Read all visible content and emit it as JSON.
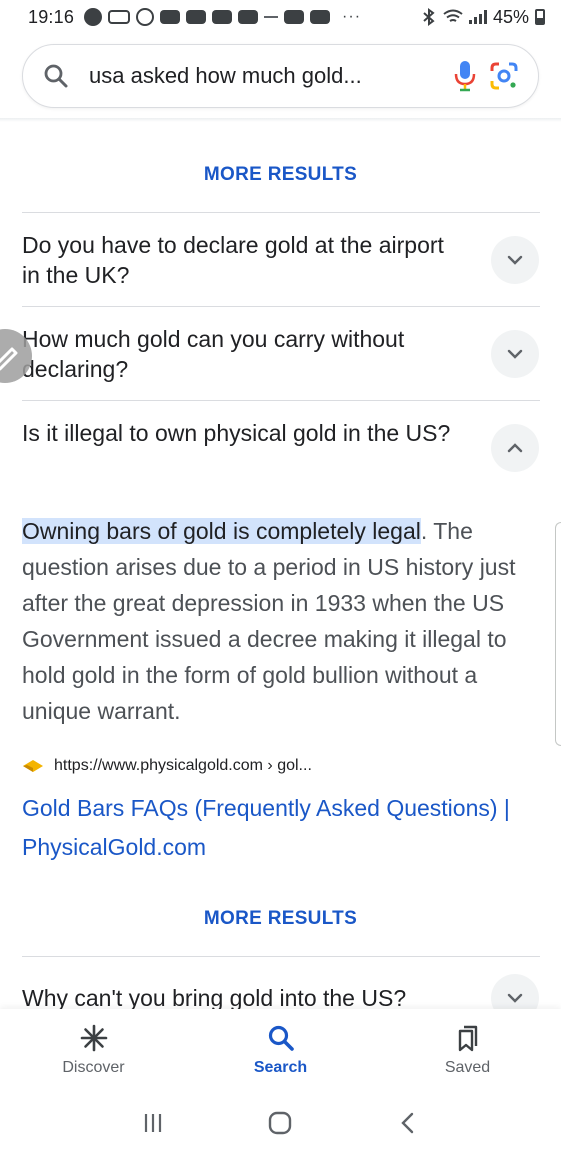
{
  "status_bar": {
    "time": "19:16",
    "battery": "45%"
  },
  "search": {
    "query": "usa asked how much gold..."
  },
  "content": {
    "more_results_top": "MORE RESULTS",
    "questions": [
      {
        "text": "Do you have to declare gold at the airport in the UK?",
        "expanded": false
      },
      {
        "text": "How much gold can you carry without declaring?",
        "expanded": false
      },
      {
        "text": "Is it illegal to own physical gold in the US?",
        "expanded": true
      }
    ],
    "answer": {
      "highlight": "Owning bars of gold is completely legal",
      "rest": ". The question arises due to a period in US history just after the great depression in 1933 when the US Government issued a decree making it illegal to hold gold in the form of gold bullion without a unique warrant."
    },
    "source": {
      "url": "https://www.physicalgold.com › gol...",
      "title": "Gold Bars FAQs (Frequently Asked Questions) | PhysicalGold.com"
    },
    "more_results_bottom": "MORE RESULTS",
    "next_question": "Why can't you bring gold into the US?"
  },
  "bottom_nav": {
    "discover": "Discover",
    "search": "Search",
    "saved": "Saved"
  },
  "colors": {
    "accent": "#1a57c7",
    "highlight": "#d2e3fc"
  }
}
